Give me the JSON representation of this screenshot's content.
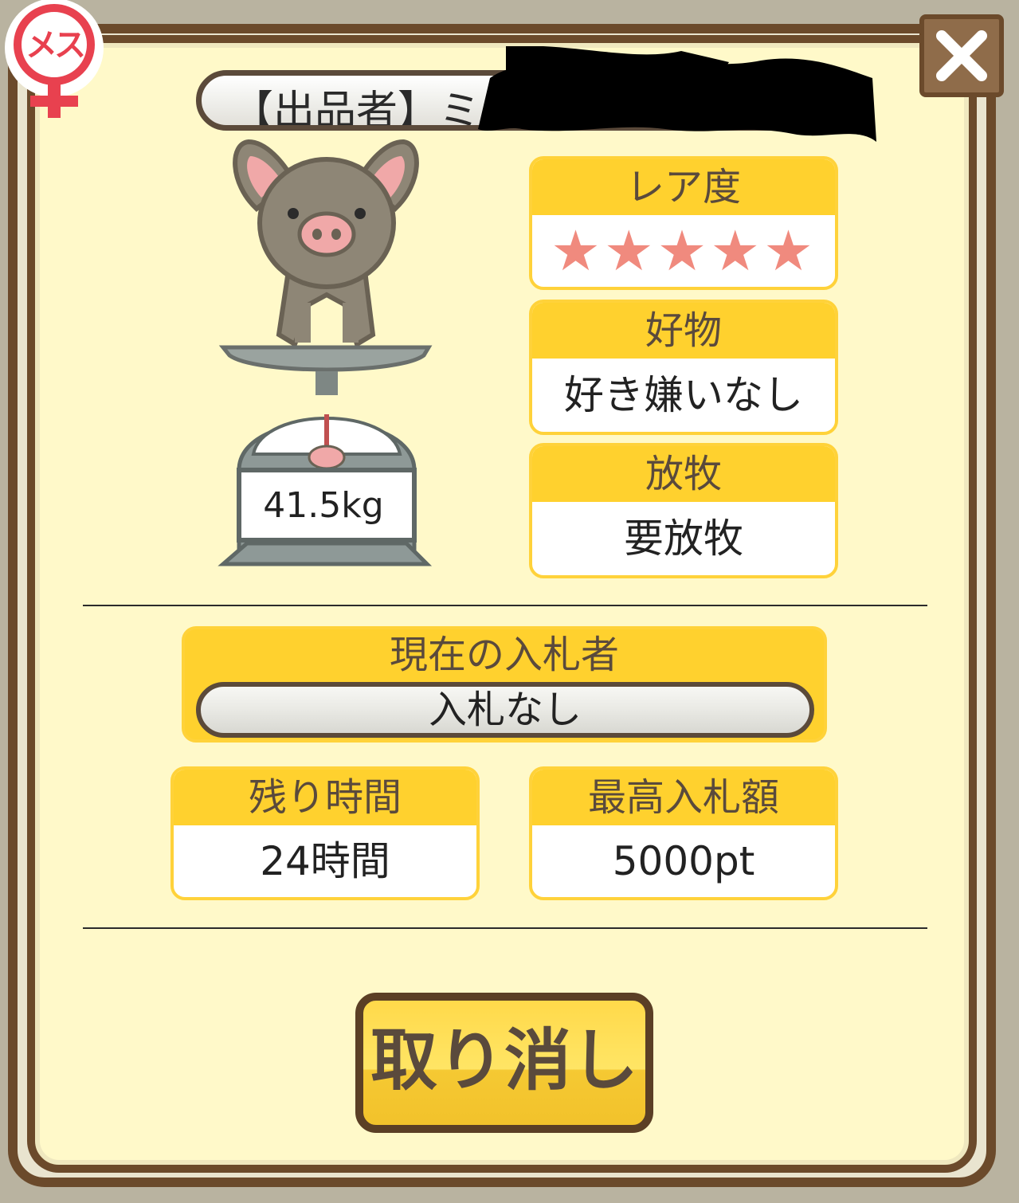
{
  "gender_badge": {
    "label": "メス",
    "color": "#e8414f"
  },
  "seller": {
    "label": "【出品者】ミ"
  },
  "weight": {
    "value": "41.5kg"
  },
  "rarity": {
    "label": "レア度",
    "stars": "★★★★★",
    "star_count": 5,
    "star_color": "#f08a7e"
  },
  "favorite_food": {
    "label": "好物",
    "value": "好き嫌いなし"
  },
  "grazing": {
    "label": "放牧",
    "value": "要放牧"
  },
  "current_bidder": {
    "label": "現在の入札者",
    "value": "入札なし"
  },
  "remaining_time": {
    "label": "残り時間",
    "value": "24時間"
  },
  "max_bid": {
    "label": "最高入札額",
    "value": "5000pt"
  },
  "cancel_button": {
    "label": "取り消し"
  },
  "colors": {
    "panel": "#fff9c9",
    "accent": "#ffd12e",
    "frame": "#6b4a2b"
  }
}
